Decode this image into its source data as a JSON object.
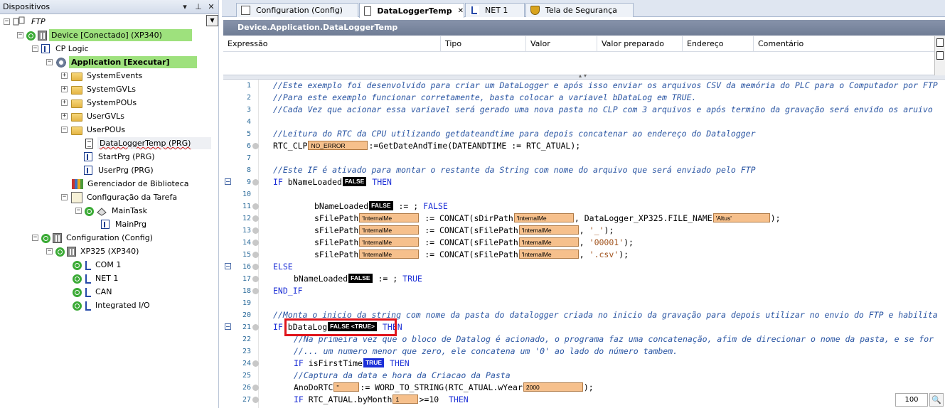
{
  "devices_panel": {
    "title": "Dispositivos",
    "pin": "📌",
    "close": "✕",
    "menu": "▾",
    "tree": [
      {
        "label": "FTP",
        "style": "italic"
      },
      {
        "label": "Device [Conectado] (XP340)"
      },
      {
        "label": "CP Logic"
      },
      {
        "label": "Application [Executar]"
      },
      {
        "label": "SystemEvents"
      },
      {
        "label": "SystemGVLs"
      },
      {
        "label": "SystemPOUs"
      },
      {
        "label": "UserGVLs"
      },
      {
        "label": "UserPOUs"
      },
      {
        "label": "DataLoggerTemp (PRG)"
      },
      {
        "label": "StartPrg (PRG)"
      },
      {
        "label": "UserPrg (PRG)"
      },
      {
        "label": "Gerenciador de Biblioteca"
      },
      {
        "label": "Configuração da Tarefa"
      },
      {
        "label": "MainTask"
      },
      {
        "label": "MainPrg"
      },
      {
        "label": "Configuration (Config)"
      },
      {
        "label": "XP325 (XP340)"
      },
      {
        "label": "COM 1"
      },
      {
        "label": "NET 1"
      },
      {
        "label": "CAN"
      },
      {
        "label": "Integrated I/O"
      }
    ]
  },
  "tabs": [
    {
      "label": "Configuration (Config)"
    },
    {
      "label": "DataLoggerTemp"
    },
    {
      "label": "NET 1"
    },
    {
      "label": "Tela de Segurança"
    }
  ],
  "tab_close": "✕",
  "editor": {
    "title": "Device.Application.DataLoggerTemp",
    "watch_columns": [
      "Expressão",
      "Tipo",
      "Valor",
      "Valor preparado",
      "Endereço",
      "Comentário"
    ],
    "zoom": "100",
    "lines": [
      {
        "n": "1",
        "text": "//Este exemplo foi desenvolvido para criar um DataLogger e após isso enviar os arquivos CSV da memória do PLC para o Computador por FTP"
      },
      {
        "n": "2",
        "text": "//Para este exemplo funcionar corretamente, basta colocar a variavel bDataLog em TRUE."
      },
      {
        "n": "3",
        "text": "//Cada Vez que acionar essa variavel será gerado uma nova pasta no CLP com 3 arquivos e após termino da gravação será envido os aruivo"
      },
      {
        "n": "4",
        "text": ""
      },
      {
        "n": "5",
        "text": "//Leitura do RTC da CPU utilizando getdateandtime para depois concatenar ao endereço do Datalogger"
      },
      {
        "n": "6",
        "a": "RTC_CLP",
        "v1": "NO_ERROR",
        "b": ":=GetDateAndTime(DATEANDTIME := RTC_ATUAL);"
      },
      {
        "n": "7",
        "text": ""
      },
      {
        "n": "8",
        "text": "//Este IF é ativado para montar o restante da String com nome do arquivo que será enviado pelo FTP"
      },
      {
        "n": "9",
        "kw1": "IF",
        "a": " bNameLoaded",
        "v1": "FALSE",
        "kw2": "THEN"
      },
      {
        "n": "10",
        "text": ""
      },
      {
        "n": "11",
        "a": "bNameLoaded",
        "v1": "FALSE",
        "b": " := ",
        "kw2": "FALSE",
        "c": ";"
      },
      {
        "n": "12",
        "a": "sFilePath",
        "v1": "'InternalMe",
        "b": " := CONCAT(sDirPath",
        "v2": "'InternalMe",
        "c": ", DataLogger_XP325.FILE_NAME",
        "v3": "'Altus'",
        "d": ");"
      },
      {
        "n": "13",
        "a": "sFilePath",
        "v1": "'InternalMe",
        "b": " := CONCAT(sFilePath",
        "v2": "'InternalMe",
        "c": ", ",
        "s": "'_'",
        "d": ");"
      },
      {
        "n": "14",
        "a": "sFilePath",
        "v1": "'InternalMe",
        "b": " := CONCAT(sFilePath",
        "v2": "'InternalMe",
        "c": ", ",
        "s": "'00001'",
        "d": ");"
      },
      {
        "n": "15",
        "a": "sFilePath",
        "v1": "'InternalMe",
        "b": " := CONCAT(sFilePath",
        "v2": "'InternalMe",
        "c": ", ",
        "s": "'.csv'",
        "d": ");"
      },
      {
        "n": "16",
        "kw1": "ELSE"
      },
      {
        "n": "17",
        "a": "bNameLoaded",
        "v1": "FALSE",
        "b": " := ",
        "kw2": "TRUE",
        "c": ";"
      },
      {
        "n": "18",
        "kw1": "END_IF"
      },
      {
        "n": "19",
        "text": ""
      },
      {
        "n": "20",
        "text": "//Monta o inicio da string com nome da pasta do datalogger criada no inicio da gravação para depois utilizar no envio do FTP e habilita"
      },
      {
        "n": "21",
        "kw1": "IF",
        "a": " bDataLog",
        "v1": "FALSE <TRUE>",
        "kw2": "THEN"
      },
      {
        "n": "22",
        "text": "//Na primeira vez que o bloco de Datalog é acionado, o programa faz uma concatenação, afim de direcionar o nome da pasta, e se for"
      },
      {
        "n": "23",
        "text": "//... um numero menor que zero, ele concatena um '0' ao lado do número tambem."
      },
      {
        "n": "24",
        "kw1": "IF",
        "a": " isFirstTime",
        "v1": "TRUE",
        "kw2": "THEN"
      },
      {
        "n": "25",
        "text": "//Captura da data e hora da Criacao da Pasta"
      },
      {
        "n": "26",
        "a": "AnoDoRTC",
        "v1": "''",
        "b": ":= WORD_TO_STRING(RTC_ATUAL.wYear",
        "v2": "2000",
        "c": ");"
      },
      {
        "n": "27",
        "kw1": "IF",
        "a": " RTC_ATUAL.byMonth",
        "v1": "1",
        "b": ">=10 ",
        "kw2": "THEN"
      }
    ]
  }
}
